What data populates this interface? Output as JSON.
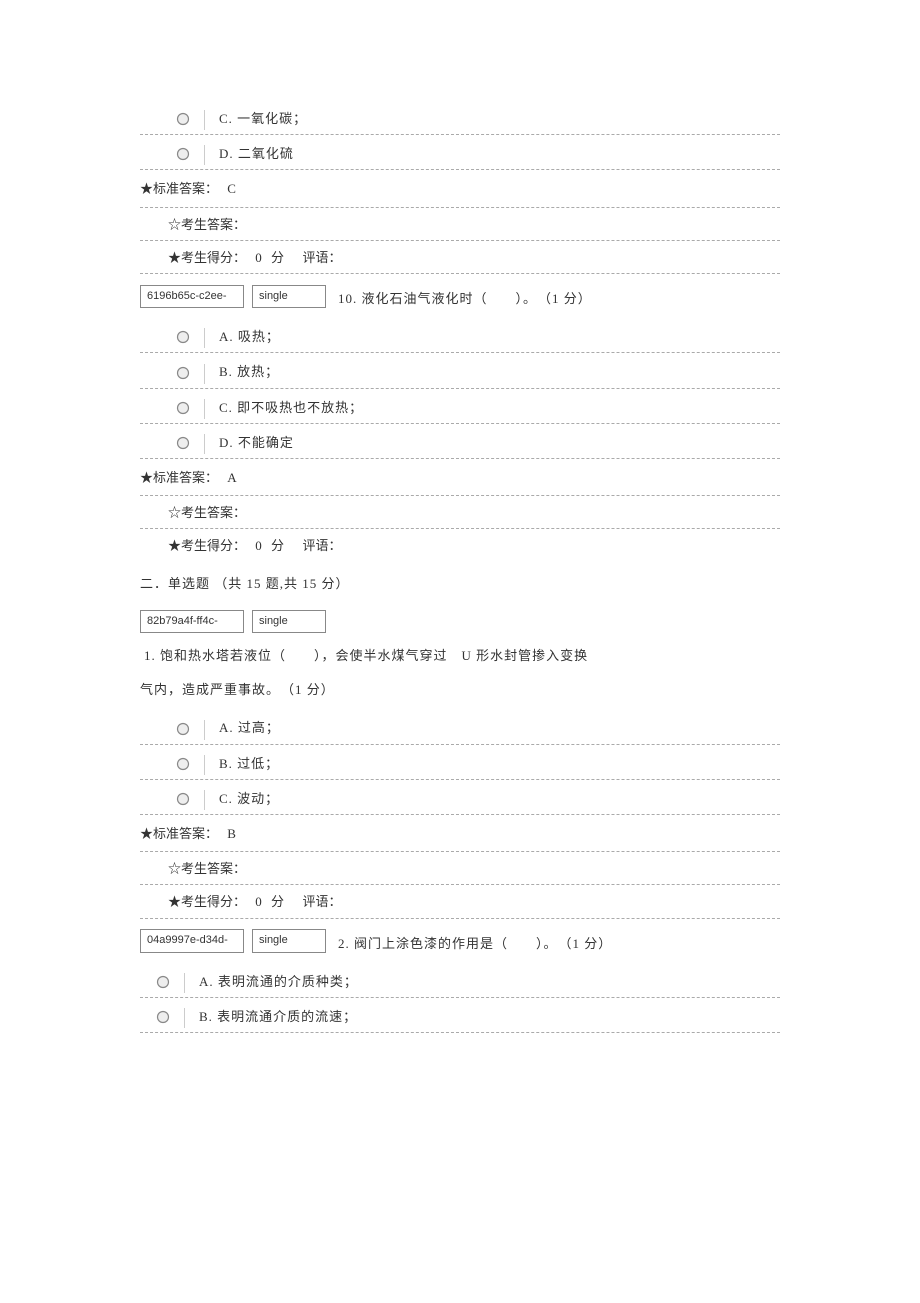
{
  "q9_tail": {
    "options": [
      {
        "label": "C. 一氧化碳；"
      },
      {
        "label": "D. 二氧化硫"
      }
    ],
    "std_answer_label": "★标准答案：",
    "std_answer_value": "C",
    "cand_answer_label": "☆考生答案：",
    "score_label": "★考生得分：",
    "score_value": "0 分",
    "comment_label": "评语："
  },
  "q10": {
    "id": "6196b65c-c2ee-",
    "type": "single",
    "text": "10. 液化石油气液化时（　　）。　（1 分）",
    "options": [
      {
        "label": "A. 吸热；"
      },
      {
        "label": "B. 放热；"
      },
      {
        "label": "C. 即不吸热也不放热；"
      },
      {
        "label": "D. 不能确定"
      }
    ],
    "std_answer_label": "★标准答案：",
    "std_answer_value": "A",
    "cand_answer_label": "☆考生答案：",
    "score_label": "★考生得分：",
    "score_value": "0 分",
    "comment_label": "评语："
  },
  "section2": {
    "title": "二．单选题 （共 15 题,共 15 分）"
  },
  "s2q1": {
    "id": "82b79a4f-ff4c-",
    "type": "single",
    "text_line1": "1. 饱和热水塔若液位（　　），会使半水煤气穿过　U 形水封管掺入变换",
    "text_line2": "气内，造成严重事故。　（1 分）",
    "options": [
      {
        "label": "A. 过高；"
      },
      {
        "label": "B. 过低；"
      },
      {
        "label": "C. 波动；"
      }
    ],
    "std_answer_label": "★标准答案：",
    "std_answer_value": "B",
    "cand_answer_label": "☆考生答案：",
    "score_label": "★考生得分：",
    "score_value": "0 分",
    "comment_label": "评语："
  },
  "s2q2": {
    "id": "04a9997e-d34d-",
    "type": "single",
    "text": "2. 阀门上涂色漆的作用是（　　）。　（1 分）",
    "options": [
      {
        "label": "A. 表明流通的介质种类；"
      },
      {
        "label": "B. 表明流通介质的流速；"
      }
    ]
  }
}
